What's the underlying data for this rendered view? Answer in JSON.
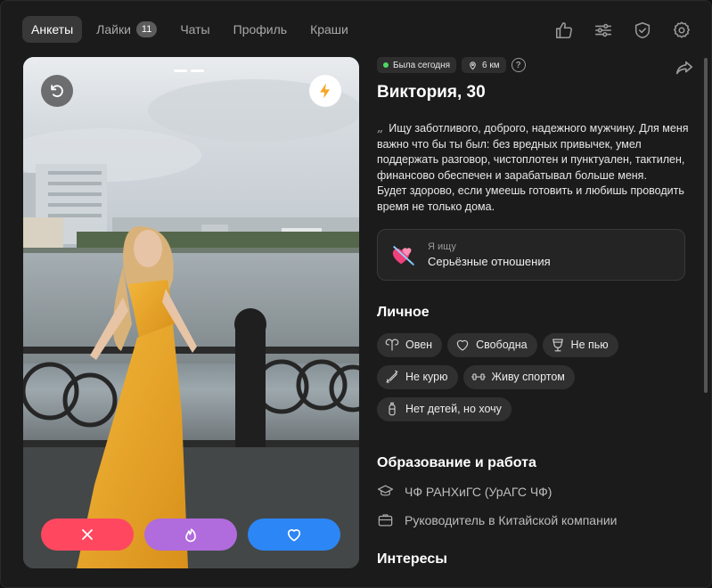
{
  "nav": {
    "tabs": [
      {
        "label": "Анкеты",
        "active": true
      },
      {
        "label": "Лайки",
        "badge": "11"
      },
      {
        "label": "Чаты"
      },
      {
        "label": "Профиль"
      },
      {
        "label": "Краши"
      }
    ],
    "icons": [
      "thumbs-up-icon",
      "filters-icon",
      "shield-check-icon",
      "settings-icon"
    ]
  },
  "profile": {
    "status": "Была сегодня",
    "distance": "6 км",
    "help": "?",
    "name": "Виктория, 30",
    "bio_line1": "Ищу заботливого, доброго, надежного мужчину. Для меня важно что бы ты был: без вредных привычек, умел поддержать разговор, чистоплотен и пунктуален, тактилен, финансово обеспечен и зарабатывал больше меня.",
    "bio_line2": "Будет здорово, если умеешь готовить и любишь проводить время не только дома.",
    "seek": {
      "label": "Я ищу",
      "value": "Серьёзные отношения"
    }
  },
  "personal": {
    "title": "Личное",
    "chips": [
      {
        "icon": "aries-icon",
        "label": "Овен"
      },
      {
        "icon": "heart-outline-icon",
        "label": "Свободна"
      },
      {
        "icon": "glass-icon",
        "label": "Не пью"
      },
      {
        "icon": "no-smoking-icon",
        "label": "Не курю"
      },
      {
        "icon": "dumbbell-icon",
        "label": "Живу спортом"
      },
      {
        "icon": "baby-bottle-icon",
        "label": "Нет детей, но хочу"
      }
    ]
  },
  "education": {
    "title": "Образование и работа",
    "items": [
      {
        "icon": "graduation-cap-icon",
        "label": "ЧФ РАНХиГС (УрАГС ЧФ)"
      },
      {
        "icon": "briefcase-icon",
        "label": "Руководитель в Китайской компании"
      }
    ]
  },
  "interests": {
    "title": "Интересы"
  },
  "colors": {
    "dislike": "#ff4860",
    "superlike": "#b06bdc",
    "like": "#2d86f5",
    "online": "#4cd964"
  }
}
